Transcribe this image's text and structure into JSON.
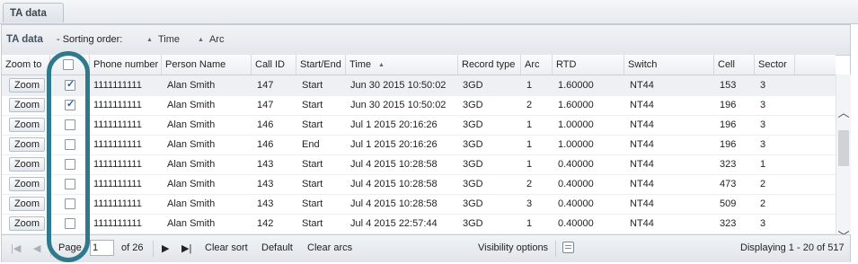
{
  "tab": {
    "label": "TA data"
  },
  "header": {
    "title": "TA data",
    "sorting_label": "- Sorting order:",
    "sort_fields": [
      "Time",
      "Arc"
    ]
  },
  "columns": [
    "Zoom to",
    "",
    "Phone number",
    "Person Name",
    "Call ID",
    "Start/End",
    "Time",
    "Record type",
    "Arc",
    "RTD",
    "Switch",
    "Cell",
    "Sector"
  ],
  "zoom_label": "Zoom",
  "rows": [
    {
      "checked": true,
      "phone": "1111111111",
      "person": "Alan Smith",
      "call_id": "147",
      "start_end": "Start",
      "time": "Jun 30 2015 10:50:02",
      "record_type": "3GD",
      "arc": "1",
      "rtd": "1.60000",
      "switch": "NT44",
      "cell": "153",
      "sector": "3"
    },
    {
      "checked": true,
      "phone": "1111111111",
      "person": "Alan Smith",
      "call_id": "147",
      "start_end": "Start",
      "time": "Jun 30 2015 10:50:02",
      "record_type": "3GD",
      "arc": "2",
      "rtd": "1.60000",
      "switch": "NT44",
      "cell": "196",
      "sector": "3"
    },
    {
      "checked": false,
      "phone": "1111111111",
      "person": "Alan Smith",
      "call_id": "146",
      "start_end": "Start",
      "time": "Jul 1 2015 20:16:26",
      "record_type": "3GD",
      "arc": "1",
      "rtd": "1.00000",
      "switch": "NT44",
      "cell": "196",
      "sector": "3"
    },
    {
      "checked": false,
      "phone": "1111111111",
      "person": "Alan Smith",
      "call_id": "146",
      "start_end": "End",
      "time": "Jul 1 2015 20:16:26",
      "record_type": "3GD",
      "arc": "1",
      "rtd": "1.00000",
      "switch": "NT44",
      "cell": "196",
      "sector": "3"
    },
    {
      "checked": false,
      "phone": "1111111111",
      "person": "Alan Smith",
      "call_id": "143",
      "start_end": "Start",
      "time": "Jul 4 2015 10:28:58",
      "record_type": "3GD",
      "arc": "1",
      "rtd": "0.40000",
      "switch": "NT44",
      "cell": "323",
      "sector": "1"
    },
    {
      "checked": false,
      "phone": "1111111111",
      "person": "Alan Smith",
      "call_id": "143",
      "start_end": "Start",
      "time": "Jul 4 2015 10:28:58",
      "record_type": "3GD",
      "arc": "2",
      "rtd": "0.40000",
      "switch": "NT44",
      "cell": "473",
      "sector": "2"
    },
    {
      "checked": false,
      "phone": "1111111111",
      "person": "Alan Smith",
      "call_id": "143",
      "start_end": "Start",
      "time": "Jul 4 2015 10:28:58",
      "record_type": "3GD",
      "arc": "3",
      "rtd": "0.40000",
      "switch": "NT44",
      "cell": "509",
      "sector": "2"
    },
    {
      "checked": false,
      "phone": "1111111111",
      "person": "Alan Smith",
      "call_id": "142",
      "start_end": "Start",
      "time": "Jul 4 2015 22:57:44",
      "record_type": "3GD",
      "arc": "1",
      "rtd": "0.40000",
      "switch": "NT44",
      "cell": "323",
      "sector": "3"
    }
  ],
  "pager": {
    "page_label": "Page",
    "page_value": "1",
    "of_label": "of 26",
    "clear_sort": "Clear sort",
    "default": "Default",
    "clear_arcs": "Clear arcs",
    "visibility": "Visibility options",
    "displaying": "Displaying 1 - 20 of 517"
  },
  "colors": {
    "highlight": "#2e7a8c",
    "checkmark": "#2a5fb0"
  },
  "icons": [
    "first-page-icon",
    "prev-page-icon",
    "next-page-icon",
    "last-page-icon",
    "visibility-options-icon",
    "scroll-up-icon",
    "scroll-down-icon",
    "sort-asc-icon"
  ]
}
